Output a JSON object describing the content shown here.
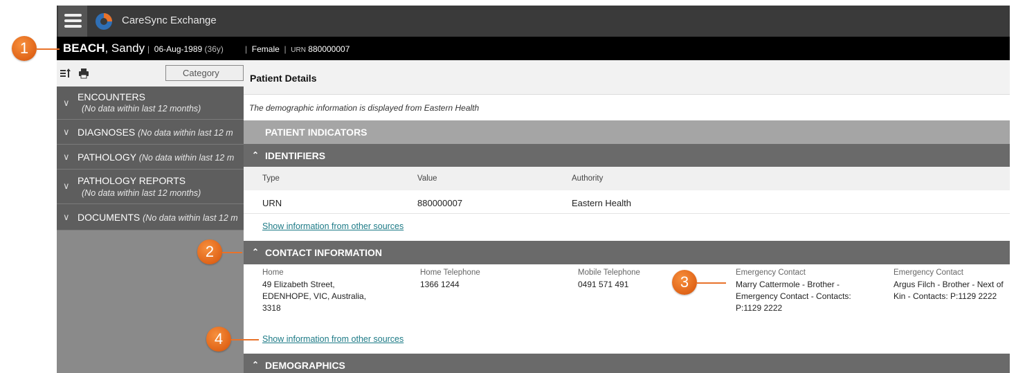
{
  "app": {
    "title": "CareSync Exchange"
  },
  "patient": {
    "surname": "BEACH",
    "given": "Sandy",
    "dob": "06-Aug-1989",
    "age": "(36y)",
    "sex": "Female",
    "urn_label": "URN",
    "urn_value": "880000007"
  },
  "sidebar": {
    "category_placeholder": "Category",
    "items": [
      {
        "label": "ENCOUNTERS",
        "note": "(No data within last 12 months)"
      },
      {
        "label": "DIAGNOSES",
        "note": "(No data within last 12 m"
      },
      {
        "label": "PATHOLOGY",
        "note": "(No data within last 12 m"
      },
      {
        "label": "PATHOLOGY REPORTS",
        "note": "(No data within last 12 months)"
      },
      {
        "label": "DOCUMENTS",
        "note": "(No data within last 12 m"
      }
    ]
  },
  "main": {
    "header": "Patient Details",
    "info": "The demographic information is displayed from Eastern Health",
    "sections": {
      "indicators": "PATIENT INDICATORS",
      "identifiers": "IDENTIFIERS",
      "contact": "CONTACT INFORMATION",
      "demographics": "DEMOGRAPHICS"
    },
    "identifiers_table": {
      "headers": [
        "Type",
        "Value",
        "Authority"
      ],
      "rows": [
        [
          "URN",
          "880000007",
          "Eastern Health"
        ]
      ]
    },
    "show_other_sources": "Show information from other sources",
    "contact": {
      "home_label": "Home",
      "home_value": "49 Elizabeth Street, EDENHOPE, VIC, Australia, 3318",
      "home_tel_label": "Home Telephone",
      "home_tel_value": "1366 1244",
      "mobile_label": "Mobile Telephone",
      "mobile_value": "0491 571 491",
      "emergency1_label": "Emergency Contact",
      "emergency1_value": "Marry Cattermole - Brother - Emergency Contact - Contacts: P:1129 2222",
      "emergency2_label": "Emergency Contact",
      "emergency2_value": "Argus Filch - Brother - Next of Kin - Contacts: P:1129 2222"
    }
  },
  "callouts": [
    "1",
    "2",
    "3",
    "4"
  ],
  "colors": {
    "callout": "#e8722a",
    "link": "#1c7a86",
    "banner": "#000000",
    "appbar": "#3a3a3a"
  }
}
